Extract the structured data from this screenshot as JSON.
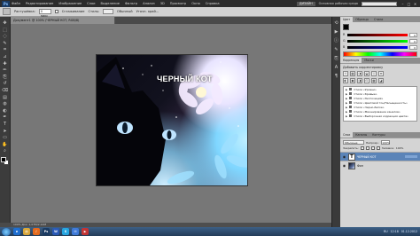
{
  "app": {
    "logo_text": "Ps",
    "menus": [
      "Файл",
      "Редактирование",
      "Изображение",
      "Слои",
      "Выделение",
      "Фильтр",
      "Анализ",
      "3D",
      "Просмотр",
      "Окно",
      "Справка"
    ],
    "workspace_button": "ДИЗАЙН",
    "workspace_label": "Основная рабочая среда",
    "window_buttons": [
      "–",
      "□",
      "✕"
    ]
  },
  "options_bar": {
    "feather_label": "Растушёвка:",
    "feather_value": "0 пикс",
    "antialias_label": "Сглаживание",
    "style_label": "Стиль:",
    "style_value": "Обычный",
    "refine_label": "Уточн. край..."
  },
  "document": {
    "tab_title": "Документ1 @ 100% (ЧЕРНЫЙ КОТ, RGB/8)",
    "artwork_title": "ЧЕРНЫЙ КОТ"
  },
  "toolbox": {
    "tools": [
      "move-tool",
      "marquee-tool",
      "lasso-tool",
      "quick-select-tool",
      "crop-tool",
      "eyedropper-tool",
      "healing-tool",
      "brush-tool",
      "clone-tool",
      "history-brush-tool",
      "eraser-tool",
      "gradient-tool",
      "blur-tool",
      "dodge-tool",
      "pen-tool",
      "type-tool",
      "path-select-tool",
      "shape-tool",
      "hand-tool",
      "zoom-tool"
    ],
    "tool_glyphs": [
      "✥",
      "⬚",
      "◌",
      "✎",
      "⌗",
      "⊿",
      "✚",
      "✏",
      "⎘",
      "↺",
      "⌫",
      "▤",
      "◍",
      "◐",
      "✒",
      "T",
      "➤",
      "▭",
      "✋",
      "⌕"
    ],
    "foreground_color": "#000000",
    "background_color": "#ffffff"
  },
  "status_bar": {
    "zoom": "100%",
    "doc_info": "Док: 1,07M/2,14M"
  },
  "panels": {
    "color_tabs": [
      "Цвет",
      "Образцы",
      "Стили"
    ],
    "color_sliders": [
      {
        "letter": "R",
        "value": "0"
      },
      {
        "letter": "G",
        "value": "0"
      },
      {
        "letter": "B",
        "value": "0"
      }
    ],
    "adjust_tabs": [
      "Коррекция",
      "Маски"
    ],
    "adjust_title": "Добавить корректировку",
    "adjust_icons": [
      "☼",
      "▦",
      "◑",
      "◒",
      "▽",
      "≡",
      "◐",
      "▣",
      "◨",
      "⊡",
      "▩",
      "◪"
    ],
    "presets": [
      "Стили «Уровни»",
      "Стили «Кривые»",
      "Стили «Экспозиция»",
      "Стили «Цветовой тон/Насыщенность»",
      "Стили «Черно-белое»",
      "Стили «Микширование каналов»",
      "Стили «Выборочная коррекция цвета»"
    ],
    "layers_tabs": [
      "Слои",
      "Каналы",
      "Контуры"
    ],
    "blend_mode": "Обычные",
    "opacity_label": "Непрозр.:",
    "opacity_value": "100%",
    "lock_label": "Закрепить:",
    "fill_label": "Заливка:",
    "fill_value": "100%",
    "layers": [
      {
        "name": "ЧЕРНЫЙ КОТ",
        "type": "text",
        "selected": true
      },
      {
        "name": "Фон",
        "type": "image",
        "selected": false
      }
    ]
  },
  "dock": {
    "icons": [
      "history-icon",
      "actions-icon",
      "info-icon",
      "brush-panel-icon",
      "clone-source-icon",
      "character-icon",
      "paragraph-icon"
    ],
    "glyphs": [
      "⟲",
      "▶",
      "ⓘ",
      "✎",
      "⎘",
      "A",
      "¶"
    ]
  },
  "taskbar": {
    "apps": [
      {
        "label": "e",
        "color": "#1f6fd1"
      },
      {
        "label": "▤",
        "color": "#d9a63b"
      },
      {
        "label": "♪",
        "color": "#e36a1d"
      },
      {
        "label": "Ps",
        "color": "#1b3b63"
      },
      {
        "label": "W",
        "color": "#2a5ab7"
      },
      {
        "label": "S",
        "color": "#26a5e0"
      },
      {
        "label": "✉",
        "color": "#3f7ad8"
      },
      {
        "label": "▶",
        "color": "#c23434"
      }
    ],
    "language": "RU",
    "time": "12:18",
    "date": "01.12.2012"
  }
}
